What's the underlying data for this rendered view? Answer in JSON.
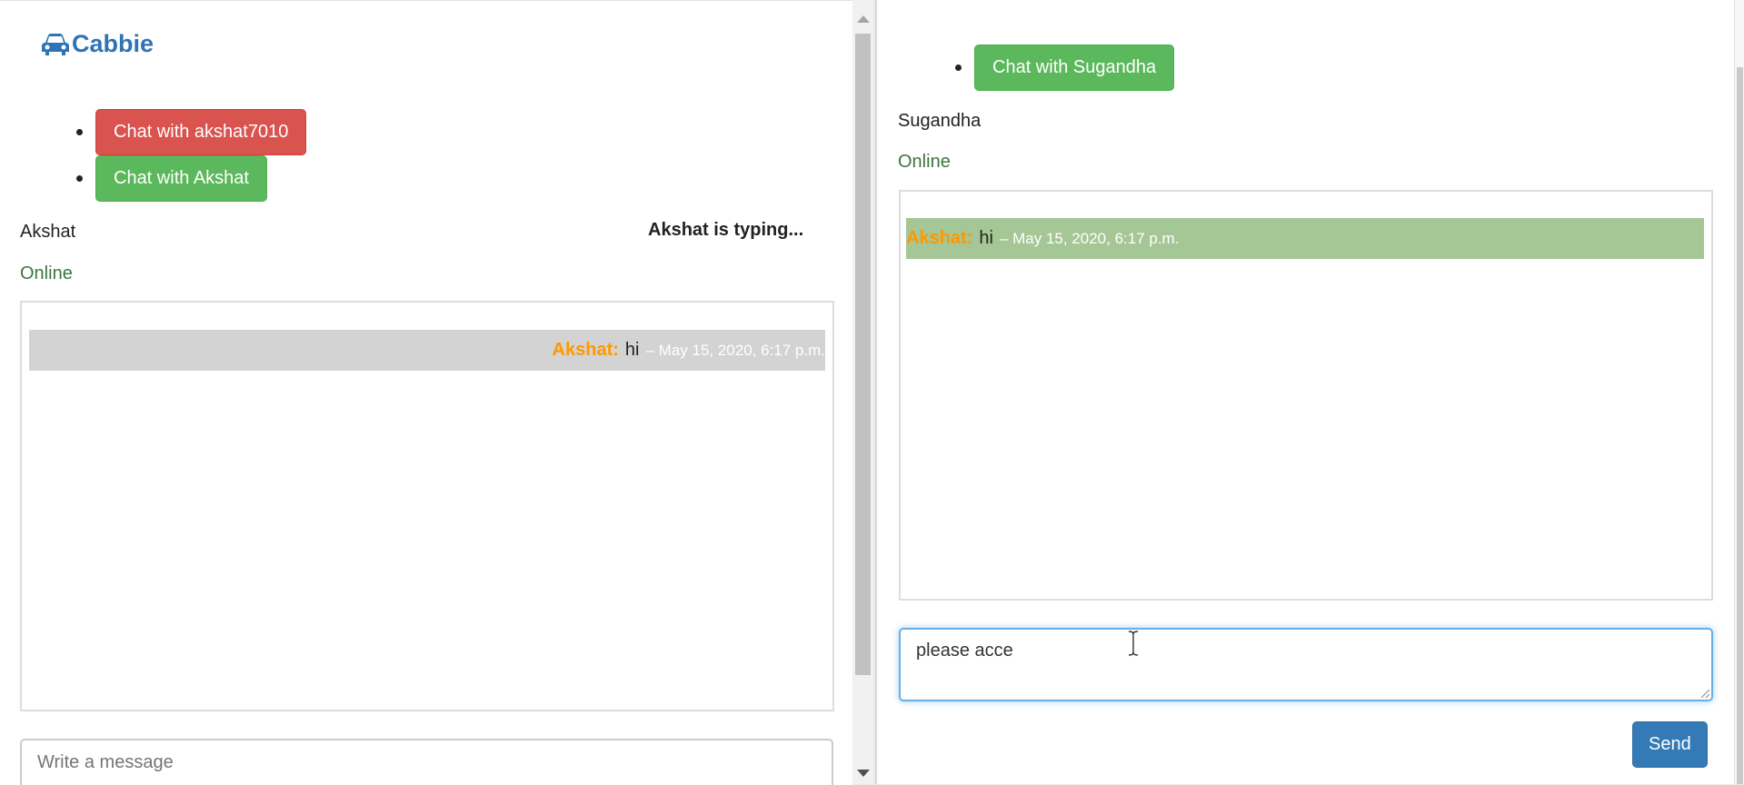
{
  "left": {
    "brand": "Cabbie",
    "users": [
      {
        "label": "Chat with akshat7010",
        "style": "danger"
      },
      {
        "label": "Chat with Akshat",
        "style": "success"
      }
    ],
    "contact_name": "Akshat",
    "status": "Online",
    "typing": "Akshat is typing...",
    "messages": [
      {
        "sender": "Akshat:",
        "text": "hi",
        "meta": "– May 15, 2020, 6:17 p.m.",
        "bg": "#d3d3d3"
      }
    ],
    "input_placeholder": "Write a message"
  },
  "right": {
    "users": [
      {
        "label": "Chat with Sugandha",
        "style": "success"
      }
    ],
    "contact_name": "Sugandha",
    "status": "Online",
    "messages": [
      {
        "sender": "Akshat:",
        "text": "hi",
        "meta": "– May 15, 2020, 6:17 p.m.",
        "bg": "#a5c795"
      }
    ],
    "input_value": "please acce",
    "send_label": "Send"
  },
  "colors": {
    "brand": "#2e73b6",
    "danger": "#d9534f",
    "success": "#5cb85c",
    "primary": "#337ab7",
    "online": "#3c763d",
    "sender": "#ff9800"
  },
  "icons": {
    "brand": "car-icon"
  }
}
